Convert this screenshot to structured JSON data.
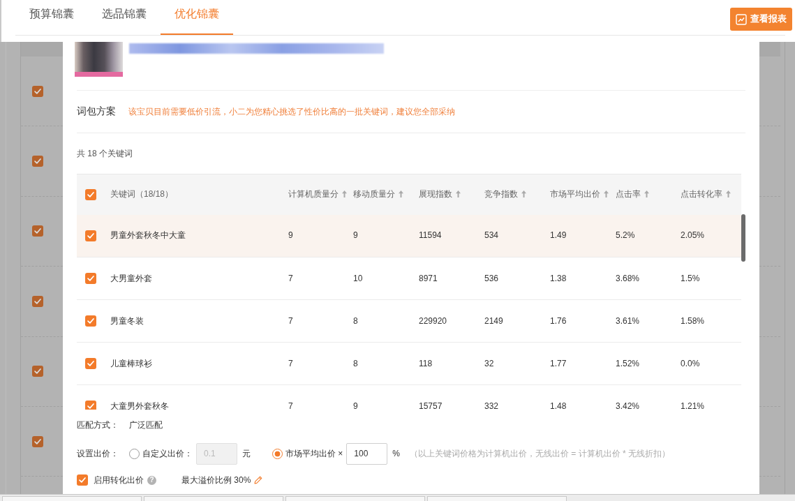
{
  "tabs": [
    {
      "label": "预算锦囊",
      "selected": false
    },
    {
      "label": "选品锦囊",
      "selected": false
    },
    {
      "label": "优化锦囊",
      "selected": true
    }
  ],
  "report_button": {
    "label": "查看报表"
  },
  "background_rows": [
    {
      "checked": true
    },
    {
      "checked": true
    },
    {
      "checked": true
    },
    {
      "checked": true
    },
    {
      "checked": true
    },
    {
      "checked": true
    }
  ],
  "plan": {
    "label": "词包方案",
    "note": "该宝贝目前需要低价引流，小二为您精心挑选了性价比高的一批关键词，建议您全部采纳"
  },
  "keyword_count": "共 18 个关键词",
  "table": {
    "select_all": {
      "checked": true
    },
    "columns": [
      {
        "label": "关键词（18/18）",
        "sortable": false
      },
      {
        "label": "计算机质量分",
        "sortable": true
      },
      {
        "label": "移动质量分",
        "sortable": true
      },
      {
        "label": "展现指数",
        "sortable": true
      },
      {
        "label": "竞争指数",
        "sortable": true
      },
      {
        "label": "市场平均出价",
        "sortable": true
      },
      {
        "label": "点击率",
        "sortable": true
      },
      {
        "label": "点击转化率",
        "sortable": true
      }
    ],
    "rows": [
      {
        "checked": true,
        "highlighted": true,
        "cells": [
          "男童外套秋冬中大童",
          "9",
          "9",
          "11594",
          "534",
          "1.49",
          "5.2%",
          "2.05%"
        ]
      },
      {
        "checked": true,
        "highlighted": false,
        "cells": [
          "大男童外套",
          "7",
          "10",
          "8971",
          "536",
          "1.38",
          "3.68%",
          "1.5%"
        ]
      },
      {
        "checked": true,
        "highlighted": false,
        "cells": [
          "男童冬装",
          "7",
          "8",
          "229920",
          "2149",
          "1.76",
          "3.61%",
          "1.58%"
        ]
      },
      {
        "checked": true,
        "highlighted": false,
        "cells": [
          "儿童棒球衫",
          "7",
          "8",
          "118",
          "32",
          "1.77",
          "1.52%",
          "0.0%"
        ]
      },
      {
        "checked": true,
        "highlighted": false,
        "cells": [
          "大童男外套秋冬",
          "7",
          "9",
          "15757",
          "332",
          "1.48",
          "3.42%",
          "1.21%"
        ]
      }
    ]
  },
  "match": {
    "label": "匹配方式：",
    "value": "广泛匹配"
  },
  "bid": {
    "label": "设置出价：",
    "options": [
      {
        "label": "自定义出价：",
        "selected": false,
        "placeholder": "0.1",
        "disabled": true,
        "unit": "元"
      },
      {
        "label": "市场平均出价 ×",
        "selected": true,
        "value": "100",
        "disabled": false,
        "unit": "%"
      }
    ],
    "note": "（以上关键词价格为计算机出价，无线出价 = 计算机出价 * 无线折扣）"
  },
  "conversion": {
    "checked": true,
    "label": "启用转化出价",
    "help": "?",
    "max_premium": "最大溢价比例 30%"
  }
}
